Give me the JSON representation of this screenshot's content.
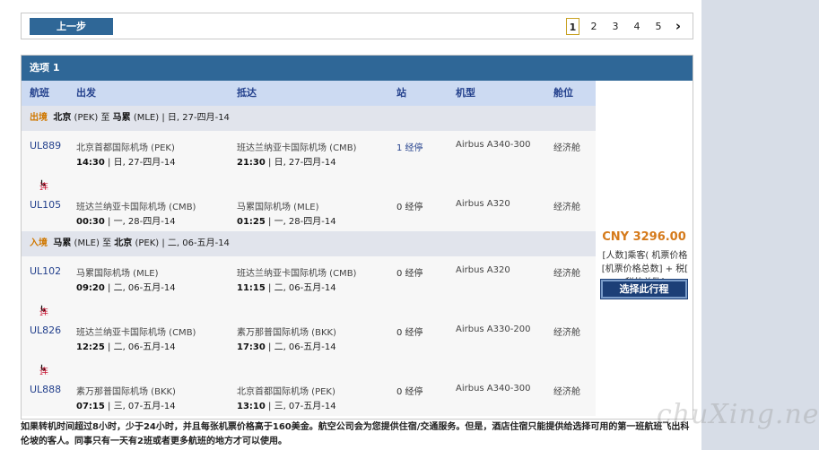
{
  "nav": {
    "prev_label": "上一步",
    "pages": [
      "1",
      "2",
      "3",
      "4",
      "5"
    ],
    "current_page": "1",
    "next_icon": "chevron-right-icon"
  },
  "option": {
    "title": "选项 1",
    "columns": {
      "flight": "航班",
      "depart": "出发",
      "arrive": "抵达",
      "stops": "站",
      "aircraft": "机型",
      "cabin": "舱位"
    },
    "outbound": {
      "tag": "出境",
      "from_city": "北京",
      "from_code": "(PEK)",
      "to_word": "至",
      "to_city": "马累",
      "to_code": "(MLE)",
      "date": "| 日, 27-四月-14",
      "connection_label": "连接",
      "legs": [
        {
          "flight": "UL889",
          "dep_airport": "北京首都国际机场 (PEK)",
          "dep_time": "14:30",
          "dep_date": "| 日, 27-四月-14",
          "arr_airport": "班达兰纳亚卡国际机场 (CMB)",
          "arr_time": "21:30",
          "arr_date": "| 日, 27-四月-14",
          "stops": "1 经停",
          "aircraft": "Airbus A340-300",
          "cabin": "经济舱"
        },
        {
          "flight": "UL105",
          "dep_airport": "班达兰纳亚卡国际机场 (CMB)",
          "dep_time": "00:30",
          "dep_date": "| 一, 28-四月-14",
          "arr_airport": "马累国际机场 (MLE)",
          "arr_time": "01:25",
          "arr_date": "| 一, 28-四月-14",
          "stops": "0 经停",
          "aircraft": "Airbus A320",
          "cabin": "经济舱"
        }
      ]
    },
    "inbound": {
      "tag": "入境",
      "from_city": "马累",
      "from_code": "(MLE)",
      "to_word": "至",
      "to_city": "北京",
      "to_code": "(PEK)",
      "date": "| 二, 06-五月-14",
      "connection_label": "连接",
      "legs": [
        {
          "flight": "UL102",
          "dep_airport": "马累国际机场 (MLE)",
          "dep_time": "09:20",
          "dep_date": "| 二, 06-五月-14",
          "arr_airport": "班达兰纳亚卡国际机场 (CMB)",
          "arr_time": "11:15",
          "arr_date": "| 二, 06-五月-14",
          "stops": "0 经停",
          "aircraft": "Airbus A320",
          "cabin": "经济舱"
        },
        {
          "flight": "UL826",
          "dep_airport": "班达兰纳亚卡国际机场 (CMB)",
          "dep_time": "12:25",
          "dep_date": "| 二, 06-五月-14",
          "arr_airport": "素万那普国际机场 (BKK)",
          "arr_time": "17:30",
          "arr_date": "| 二, 06-五月-14",
          "stops": "0 经停",
          "aircraft": "Airbus A330-200",
          "cabin": "经济舱"
        },
        {
          "flight": "UL888",
          "dep_airport": "素万那普国际机场 (BKK)",
          "dep_time": "07:15",
          "dep_date": "| 三, 07-五月-14",
          "arr_airport": "北京首都国际机场 (PEK)",
          "arr_time": "13:10",
          "arr_date": "| 三, 07-五月-14",
          "stops": "0 经停",
          "aircraft": "Airbus A340-300",
          "cabin": "经济舱"
        }
      ]
    },
    "price": "CNY 3296.00",
    "price_note": "[人数]乘客( 机票价格[机票价格总数] + 税[ 税的总数]",
    "select_label": "选择此行程"
  },
  "footnote": "如果转机时间超过8小时，少于24小时，并且每张机票价格高于160美金。航空公司会为您提供住宿/交通服务。但是，酒店住宿只能提供给选择可用的第一班航班飞出科伦坡的客人。同事只有一天有2班或者更多航班的地方才可以使用。",
  "watermark": "chuXing.net",
  "colors": {
    "header_blue": "#2f6797",
    "link_blue": "#24418d",
    "price_orange": "#d57a1b",
    "connect_red": "#c8102e",
    "tag_orange": "#d07800"
  }
}
